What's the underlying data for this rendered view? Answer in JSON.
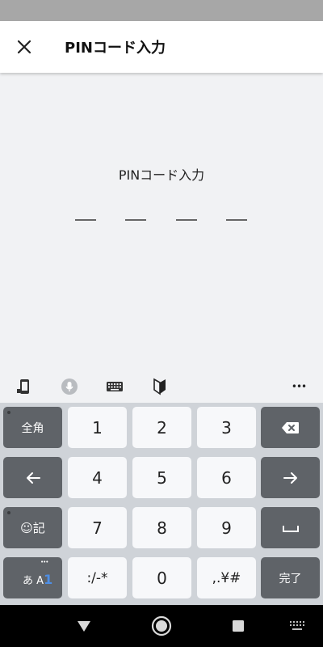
{
  "app_bar": {
    "title": "PINコード入力",
    "close_icon": "close-icon"
  },
  "pin": {
    "prompt": "PINコード入力",
    "slot_count": 4,
    "entered": ""
  },
  "toolbar": {
    "icons": [
      "phone-sync-icon",
      "microphone-icon",
      "keyboard-icon",
      "beginner-mark-icon",
      "more-icon"
    ],
    "more_label": "•••"
  },
  "keyboard": {
    "mode_full_width": "全角",
    "keys_row1": [
      "1",
      "2",
      "3"
    ],
    "keys_row2": [
      "4",
      "5",
      "6"
    ],
    "keys_row3": [
      "7",
      "8",
      "9"
    ],
    "emoji_symbol": "☺記",
    "input_mode_a": "あ",
    "input_mode_b": "A",
    "input_mode_c": "1",
    "input_mode_dots": "•••",
    "symbols_key": ":/-*",
    "zero_key": "0",
    "punct_key": ",.¥#",
    "done_key": "完了",
    "colors": {
      "dark_key": "#5f6368",
      "light_key": "#f7f8fa",
      "accent": "#4e8fe6"
    }
  },
  "nav": {
    "icons": [
      "back-icon",
      "home-icon",
      "recents-icon",
      "keyboard-switch-icon"
    ]
  }
}
